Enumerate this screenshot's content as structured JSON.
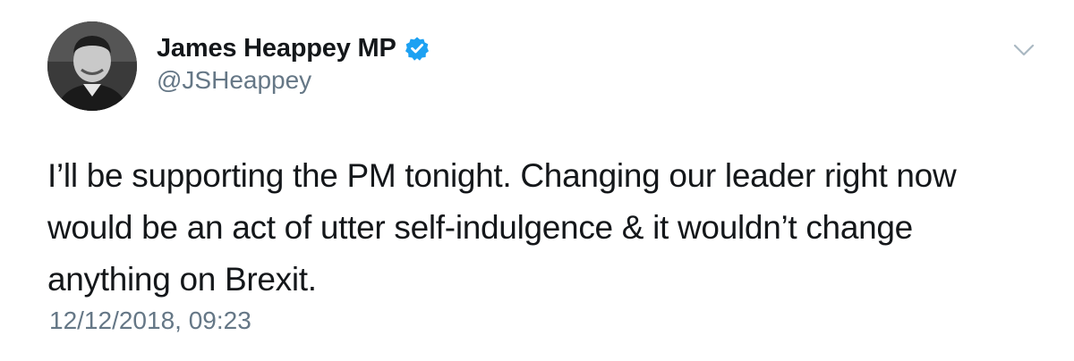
{
  "author": {
    "display_name": "James Heappey MP",
    "handle": "@JSHeappey",
    "verified": true,
    "avatar_icon": "profile-photo-avatar"
  },
  "menu": {
    "icon": "chevron-down-icon"
  },
  "tweet": {
    "text_lines": [
      "I’ll be supporting the PM tonight. Changing our leader right now",
      "would be an act of utter self-indulgence & it wouldn’t change",
      "anything on Brexit."
    ],
    "timestamp": "12/12/2018, 09:23"
  },
  "colors": {
    "text_primary": "#14171a",
    "text_secondary": "#657786",
    "verified_blue": "#1da1f2",
    "chevron_gray": "#aab8c2"
  }
}
